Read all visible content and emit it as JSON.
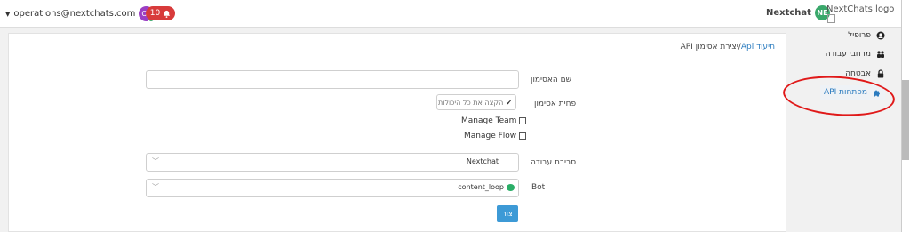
{
  "topbar": {
    "user_email": "operations@nextchats.com",
    "user_initials": "OP",
    "notification_count": "10",
    "brand_name": "Nextchat",
    "brand_initials": "NE",
    "logo_alt": "NextChats logo"
  },
  "breadcrumb": {
    "link": "תיעוד Api",
    "separator": "/",
    "current": "יצירת אסימון API"
  },
  "form": {
    "token_name_label": "שם האסימון",
    "token_name_value": "",
    "scope_label": "פחית אסימון",
    "scope_value": "הקצה את כל היכולות",
    "manage_team_label": "Manage Team",
    "manage_flow_label": "Manage Flow",
    "workspace_label": "סביבת עבודה",
    "workspace_value": "Nextchat",
    "bot_label": "Bot",
    "bot_value": "content_loop",
    "submit_label": "צור"
  },
  "sidebar": {
    "items": [
      {
        "label": "פרופיל",
        "icon": "user-circle-icon"
      },
      {
        "label": "מרחבי עבודה",
        "icon": "users-icon"
      },
      {
        "label": "אבטחה",
        "icon": "lock-icon"
      },
      {
        "label": "מפתחות API",
        "icon": "puzzle-icon",
        "active": true
      }
    ]
  },
  "colors": {
    "accent": "#3d9ad6",
    "link": "#2a7bbf",
    "notification": "#d83b3b",
    "annotation": "#e01919"
  }
}
